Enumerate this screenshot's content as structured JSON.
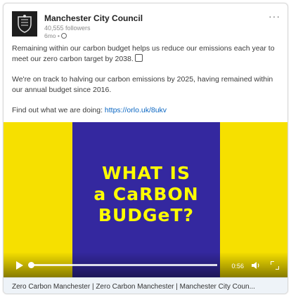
{
  "post": {
    "org_name": "Manchester City Council",
    "followers": "40,555 followers",
    "time": "6mo •",
    "more": "···",
    "para1": "Remaining within our carbon budget helps us reduce our emissions each year to meet our zero carbon target by 2038.",
    "para2": "We're on track to halving our carbon emissions by 2025, having remained within our annual budget since 2016.",
    "para3_prefix": "Find out what we are doing: ",
    "link": "https://orlo.uk/8ukv"
  },
  "video": {
    "title_line1": "WHAT IS",
    "title_line2": "a CaRBON",
    "title_line3": "BUDGeT?",
    "time": "0:56",
    "progress_fraction": 0.0
  },
  "footer": {
    "link_title": "Zero Carbon Manchester | Zero Carbon Manchester | Manchester City Coun..."
  },
  "colors": {
    "video_yellow": "#f6e000",
    "video_panel": "#34289f",
    "title_text": "#ffff00",
    "link": "#0a66c2"
  }
}
